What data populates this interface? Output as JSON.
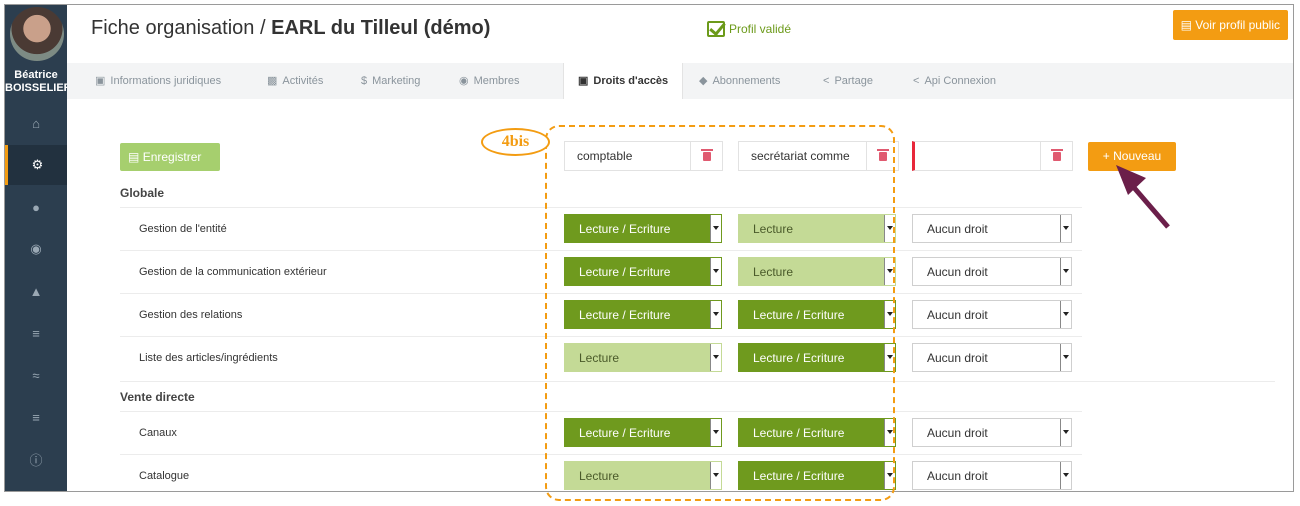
{
  "header": {
    "title_prefix": "Fiche organisation / ",
    "title_bold": "EARL du Tilleul (démo)",
    "status": "Profil validé",
    "public_button": "Voir profil public"
  },
  "user": {
    "first_name": "Béatrice",
    "last_name": "BOISSELIER"
  },
  "sidebar_icons": [
    "home-icon",
    "cogs-icon",
    "chat-icon",
    "users-icon",
    "bell-icon",
    "cart-icon",
    "handshake-icon",
    "cart-plus-icon",
    "info-icon"
  ],
  "tabs": [
    {
      "label": "Informations juridiques",
      "icon": "folder-icon"
    },
    {
      "label": "Activités",
      "icon": "chart-icon"
    },
    {
      "label": "Marketing",
      "icon": "dollar-icon"
    },
    {
      "label": "Membres",
      "icon": "users-icon"
    },
    {
      "label": "Droits d'accès",
      "icon": "lock-icon"
    },
    {
      "label": "Abonnements",
      "icon": "tag-icon"
    },
    {
      "label": "Partage",
      "icon": "share-icon"
    },
    {
      "label": "Api Connexion",
      "icon": "share-icon"
    }
  ],
  "toolbar": {
    "save_label": "Enregistrer",
    "new_label": "+ Nouveau"
  },
  "roles": [
    "comptable",
    "secrétariat comme",
    ""
  ],
  "annotation": {
    "tag": "4bis"
  },
  "sections": [
    {
      "title": "Globale",
      "rows": [
        {
          "label": "Gestion de l'entité",
          "values": [
            "Lecture / Ecriture",
            "Lecture",
            "Aucun droit"
          ]
        },
        {
          "label": "Gestion de la communication extérieur",
          "values": [
            "Lecture / Ecriture",
            "Lecture",
            "Aucun droit"
          ]
        },
        {
          "label": "Gestion des relations",
          "values": [
            "Lecture / Ecriture",
            "Lecture / Ecriture",
            "Aucun droit"
          ]
        },
        {
          "label": "Liste des articles/ingrédients",
          "values": [
            "Lecture",
            "Lecture / Ecriture",
            "Aucun droit"
          ]
        }
      ]
    },
    {
      "title": "Vente directe",
      "rows": [
        {
          "label": "Canaux",
          "values": [
            "Lecture / Ecriture",
            "Lecture / Ecriture",
            "Aucun droit"
          ]
        },
        {
          "label": "Catalogue",
          "values": [
            "Lecture",
            "Lecture / Ecriture",
            "Aucun droit"
          ]
        }
      ]
    }
  ],
  "colors": {
    "sidebar": "#2c3e4f",
    "accent": "#f39c12",
    "read_write": "#6f9a1e",
    "read": "#c4da96",
    "validated": "#6c9a1a",
    "arrow": "#6b1f4a"
  }
}
